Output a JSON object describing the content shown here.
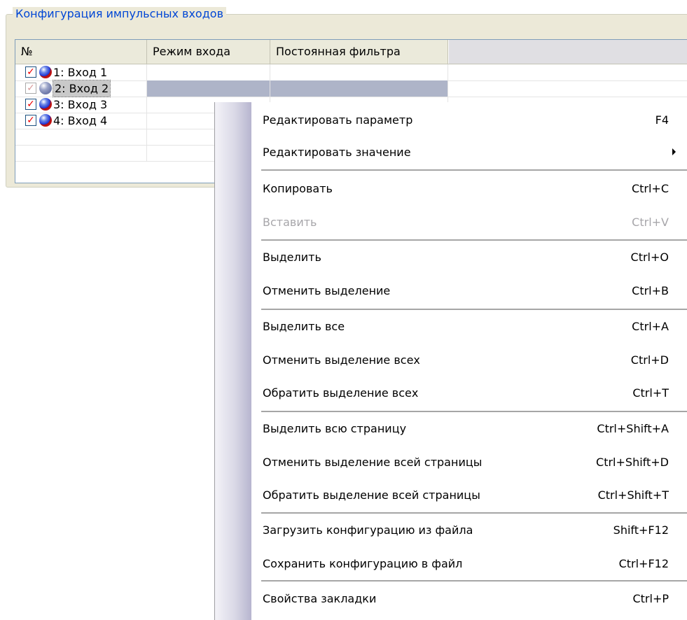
{
  "group": {
    "title": "Конфигурация импульсных входов"
  },
  "grid": {
    "columns": [
      "№",
      "Режим входа",
      "Постоянная фильтра"
    ],
    "rows": [
      {
        "label": "1: Вход 1",
        "checked": true,
        "enabled": true
      },
      {
        "label": "2: Вход 2",
        "checked": true,
        "enabled": false,
        "selected": true
      },
      {
        "label": "3: Вход 3",
        "checked": true,
        "enabled": true
      },
      {
        "label": "4: Вход 4",
        "checked": true,
        "enabled": true
      }
    ]
  },
  "menu": {
    "items": [
      {
        "label": "Редактировать параметр",
        "shortcut": "F4"
      },
      {
        "label": "Редактировать значение",
        "shortcut": "",
        "submenu": true
      },
      {
        "label": "Копировать",
        "shortcut": "Ctrl+C"
      },
      {
        "label": "Вставить",
        "shortcut": "Ctrl+V",
        "disabled": true
      },
      {
        "label": "Выделить",
        "shortcut": "Ctrl+O"
      },
      {
        "label": "Отменить выделение",
        "shortcut": "Ctrl+B"
      },
      {
        "label": "Выделить все",
        "shortcut": "Ctrl+A"
      },
      {
        "label": "Отменить выделение всех",
        "shortcut": "Ctrl+D"
      },
      {
        "label": "Обратить выделение всех",
        "shortcut": "Ctrl+T"
      },
      {
        "label": "Выделить всю страницу",
        "shortcut": "Ctrl+Shift+A"
      },
      {
        "label": "Отменить выделение всей страницы",
        "shortcut": "Ctrl+Shift+D"
      },
      {
        "label": "Обратить выделение всей страницы",
        "shortcut": "Ctrl+Shift+T"
      },
      {
        "label": "Загрузить конфигурацию из файла",
        "shortcut": "Shift+F12"
      },
      {
        "label": "Сохранить конфигурацию в файл",
        "shortcut": "Ctrl+F12"
      },
      {
        "label": "Свойства закладки",
        "shortcut": "Ctrl+P"
      }
    ]
  },
  "colors": {
    "title": "#0046d5",
    "selection": "#aeb4c8",
    "check": "#ee0000"
  }
}
